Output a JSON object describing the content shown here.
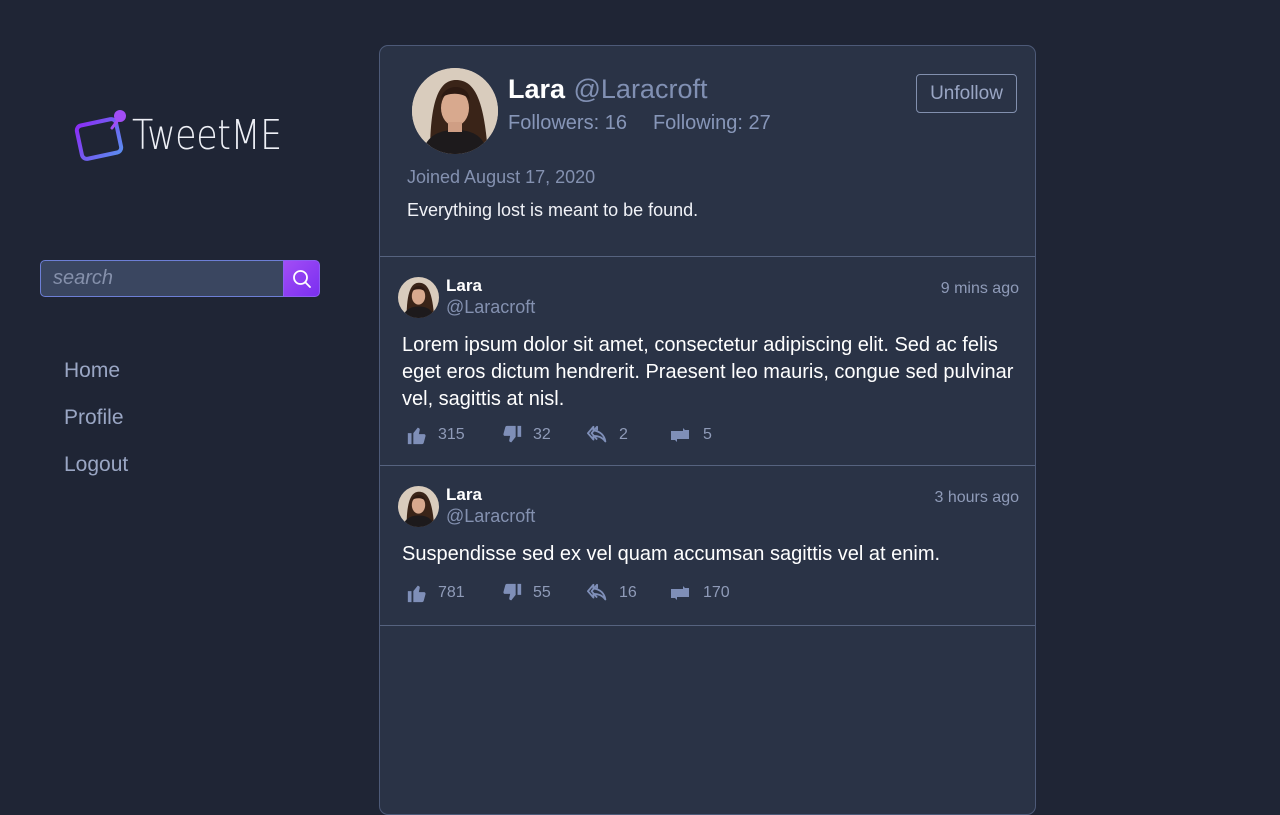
{
  "brand": {
    "name": "TweetME",
    "accent": "#8b3cf6"
  },
  "search": {
    "placeholder": "search",
    "icon": "search-icon"
  },
  "nav": [
    {
      "label": "Home"
    },
    {
      "label": "Profile"
    },
    {
      "label": "Logout"
    }
  ],
  "profile": {
    "name": "Lara",
    "handle": "@Laracroft",
    "followers": "Followers: 16",
    "following": "Following: 27",
    "button": "Unfollow",
    "joined": "Joined August 17, 2020",
    "bio": "Everything lost is meant to be found."
  },
  "tweets": [
    {
      "name": "Lara",
      "handle": "@Laracroft",
      "time": "9 mins ago",
      "text": "Lorem ipsum dolor sit amet, consectetur adipiscing elit. Sed ac felis eget eros dictum hendrerit. Praesent leo mauris, congue sed pulvinar vel, sagittis at nisl.",
      "likes": "315",
      "dislikes": "32",
      "replies": "2",
      "retweets": "5"
    },
    {
      "name": "Lara",
      "handle": "@Laracroft",
      "time": "3 hours ago",
      "text": "Suspendisse sed ex vel quam accumsan sagittis vel at enim.",
      "likes": "781",
      "dislikes": "55",
      "replies": "16",
      "retweets": "170"
    }
  ]
}
